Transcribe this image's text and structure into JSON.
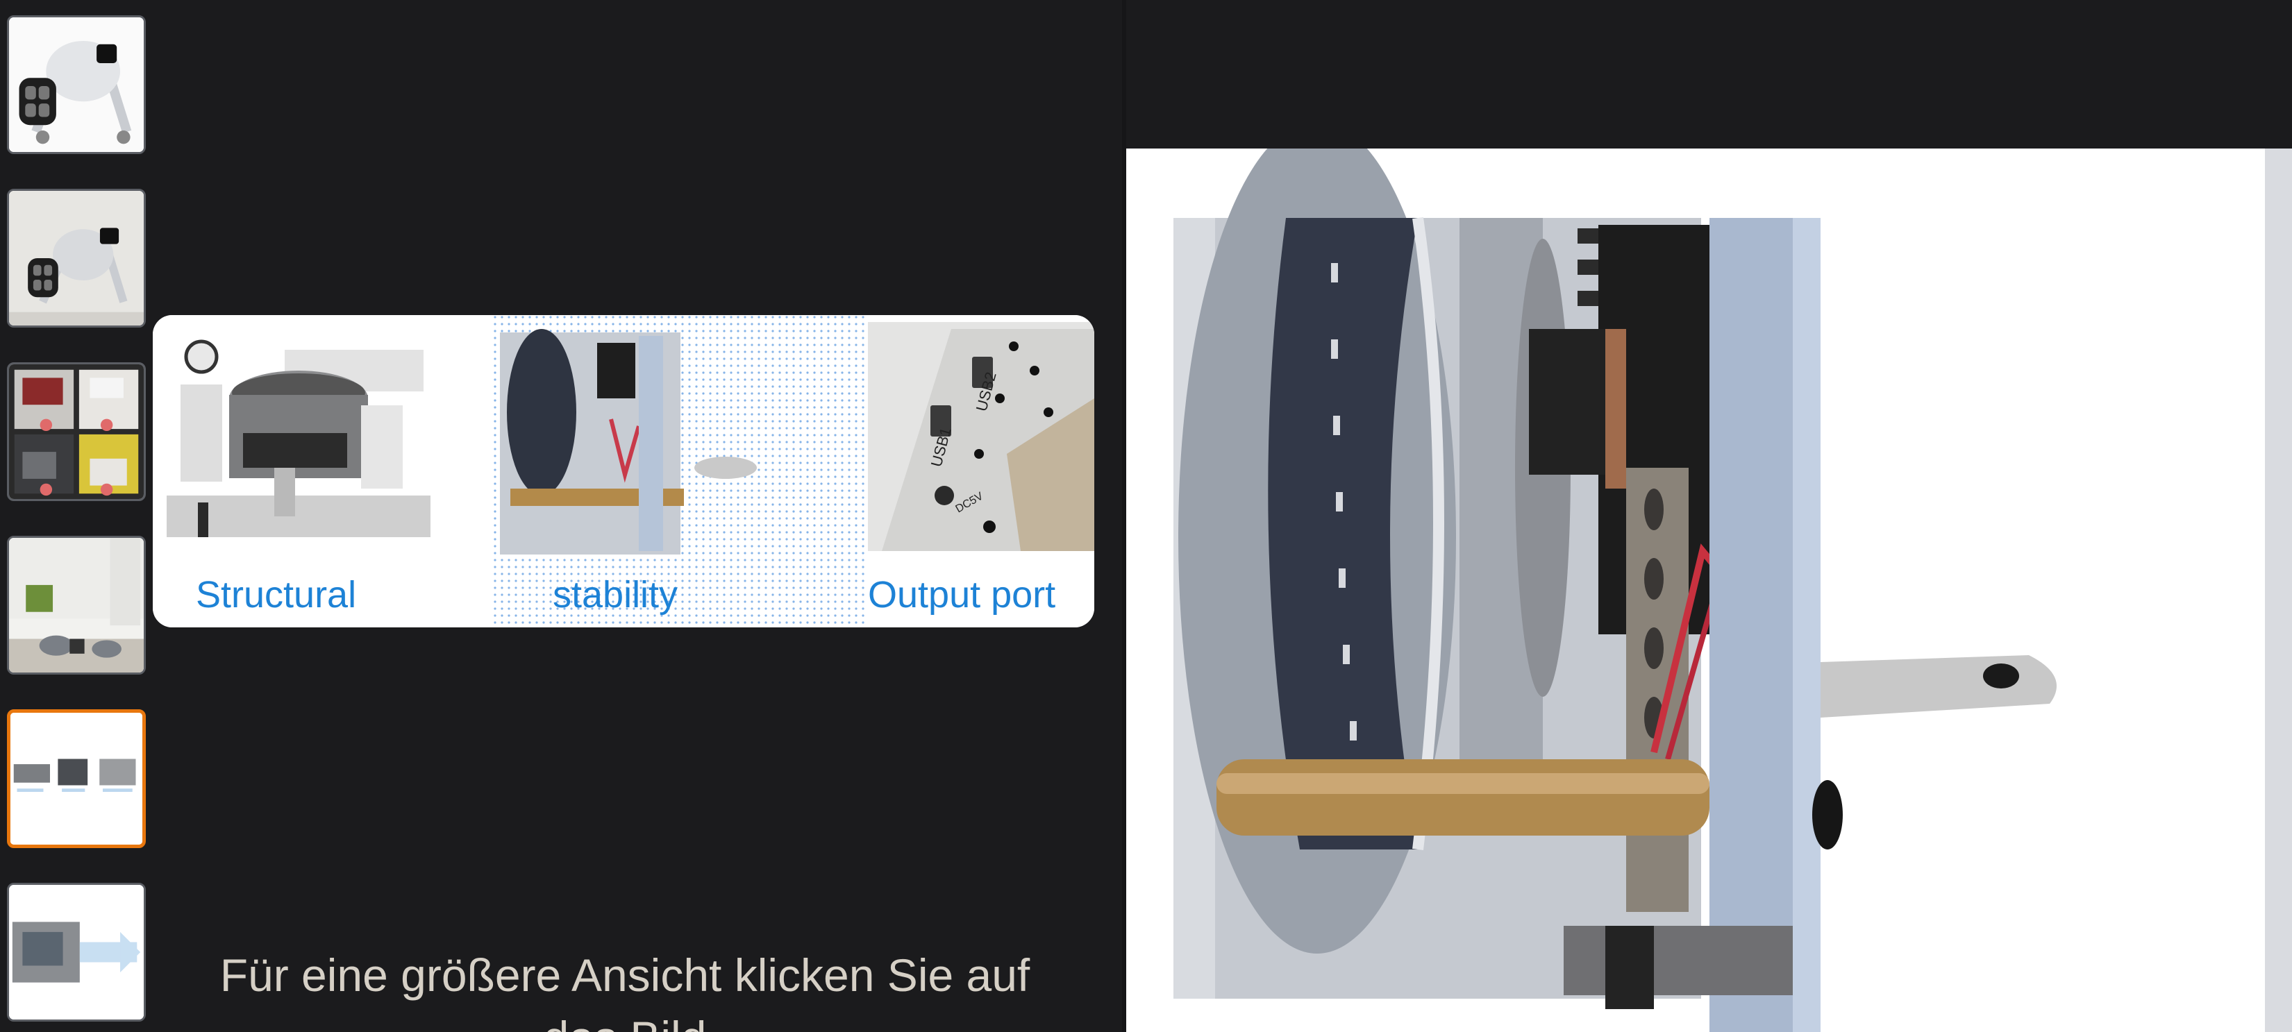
{
  "thumbnails": [
    {
      "name": "thumb-1",
      "icon": "exercise-bike-photo"
    },
    {
      "name": "thumb-2",
      "icon": "exercise-bike-photo"
    },
    {
      "name": "thumb-3",
      "icon": "usage-scenes-photo"
    },
    {
      "name": "thumb-4",
      "icon": "living-room-photo"
    },
    {
      "name": "thumb-5",
      "icon": "feature-details-photo",
      "selected": true
    },
    {
      "name": "thumb-6",
      "icon": "product-detail-photo"
    }
  ],
  "preview": {
    "captions": {
      "structural": "Structural",
      "stability": "stability",
      "output_port": "Output port"
    },
    "port_labels": {
      "usb1": "USB1",
      "usb2": "USB2",
      "dc": "DC5V"
    }
  },
  "hint": {
    "text": "Für eine größere Ansicht klicken Sie auf das Bild"
  },
  "colors": {
    "background": "#1b1b1d",
    "selected_border": "#e8770e",
    "caption_blue": "#1d82d6"
  }
}
